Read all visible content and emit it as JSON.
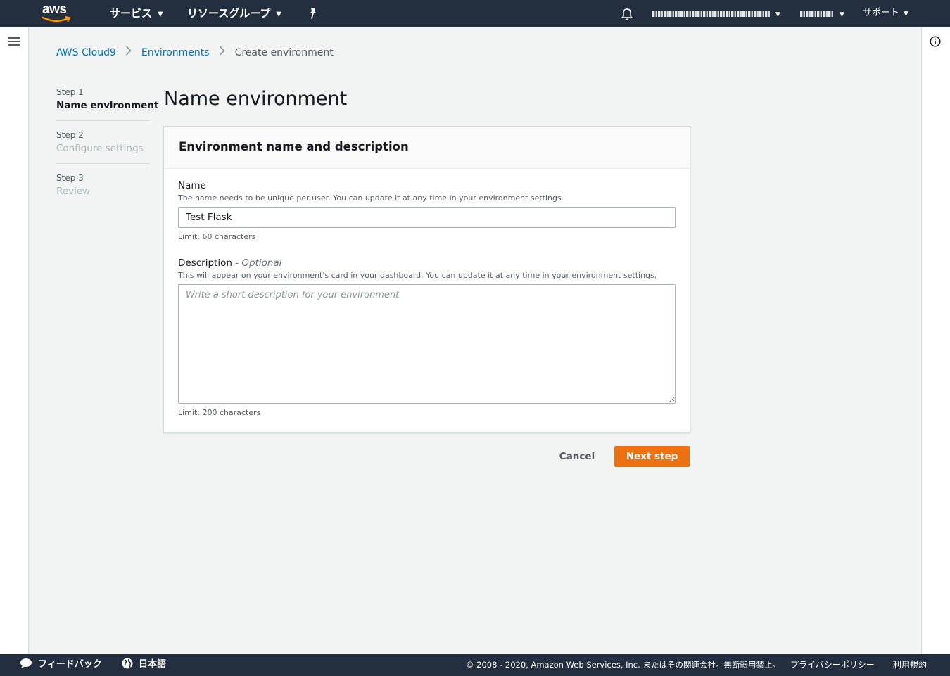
{
  "header": {
    "logo_text": "aws",
    "services_label": "サービス",
    "resource_groups_label": "リソースグループ",
    "account_label": "(redacted)",
    "region_label": "(redacted)",
    "support_label": "サポート"
  },
  "breadcrumb": {
    "items": [
      "AWS Cloud9",
      "Environments",
      "Create environment"
    ]
  },
  "steps": [
    {
      "number": "Step 1",
      "title": "Name environment",
      "active": true
    },
    {
      "number": "Step 2",
      "title": "Configure settings",
      "active": false
    },
    {
      "number": "Step 3",
      "title": "Review",
      "active": false
    }
  ],
  "page_title": "Name environment",
  "panel": {
    "title": "Environment name and description",
    "name": {
      "label": "Name",
      "hint": "The name needs to be unique per user. You can update it at any time in your environment settings.",
      "value": "Test Flask",
      "limit": "Limit: 60 characters"
    },
    "description": {
      "label": "Description",
      "optional": "- Optional",
      "hint": "This will appear on your environment's card in your dashboard. You can update it at any time in your environment settings.",
      "placeholder": "Write a short description for your environment",
      "value": "",
      "limit": "Limit: 200 characters"
    }
  },
  "actions": {
    "cancel_label": "Cancel",
    "next_label": "Next step"
  },
  "footer": {
    "feedback_label": "フィードバック",
    "language_label": "日本語",
    "copyright": "© 2008 - 2020, Amazon Web Services, Inc. またはその関連会社。無断転用禁止。",
    "privacy_label": "プライバシーポリシー",
    "terms_label": "利用規約"
  },
  "colors": {
    "nav_bg": "#232f3e",
    "accent": "#ec7211",
    "link": "#0073bb",
    "logo_smile": "#ff9900"
  },
  "icons": [
    "aws-logo",
    "chevron-down-icon",
    "pin-icon",
    "bell-icon",
    "hamburger-menu-icon",
    "info-icon",
    "chevron-right-icon",
    "speech-bubble-icon",
    "globe-icon"
  ]
}
